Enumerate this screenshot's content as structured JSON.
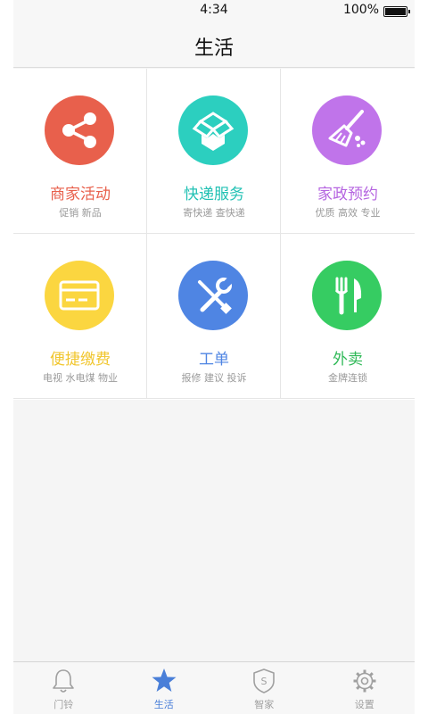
{
  "status_bar": {
    "time": "4:34",
    "battery_percent": "100%"
  },
  "header": {
    "title": "生活"
  },
  "services": [
    {
      "title": "商家活动",
      "subtitle": "促销 新品",
      "color": "#e8604c",
      "title_color": "#e8604c",
      "icon": "share-icon"
    },
    {
      "title": "快递服务",
      "subtitle": "寄快递 查快递",
      "color": "#2ccfbf",
      "title_color": "#22c1b4",
      "icon": "package-icon"
    },
    {
      "title": "家政预约",
      "subtitle": "优质 高效 专业",
      "color": "#c074ea",
      "title_color": "#b564e0",
      "icon": "broom-icon"
    },
    {
      "title": "便捷缴费",
      "subtitle": "电视 水电煤 物业",
      "color": "#fbd640",
      "title_color": "#f1c62e",
      "icon": "card-icon"
    },
    {
      "title": "工单",
      "subtitle": "报修 建议 投诉",
      "color": "#4f85e3",
      "title_color": "#4f85e3",
      "icon": "tools-icon"
    },
    {
      "title": "外卖",
      "subtitle": "金牌连锁",
      "color": "#36cc62",
      "title_color": "#2fb957",
      "icon": "fork-knife-icon"
    }
  ],
  "tabs": [
    {
      "label": "门铃",
      "icon": "bell-icon",
      "active": false
    },
    {
      "label": "生活",
      "icon": "star-icon",
      "active": true
    },
    {
      "label": "智家",
      "icon": "shield-icon",
      "active": false
    },
    {
      "label": "设置",
      "icon": "gear-icon",
      "active": false
    }
  ],
  "colors": {
    "active_tab": "#4a7fd8",
    "inactive_tab": "#a0a0a0"
  }
}
